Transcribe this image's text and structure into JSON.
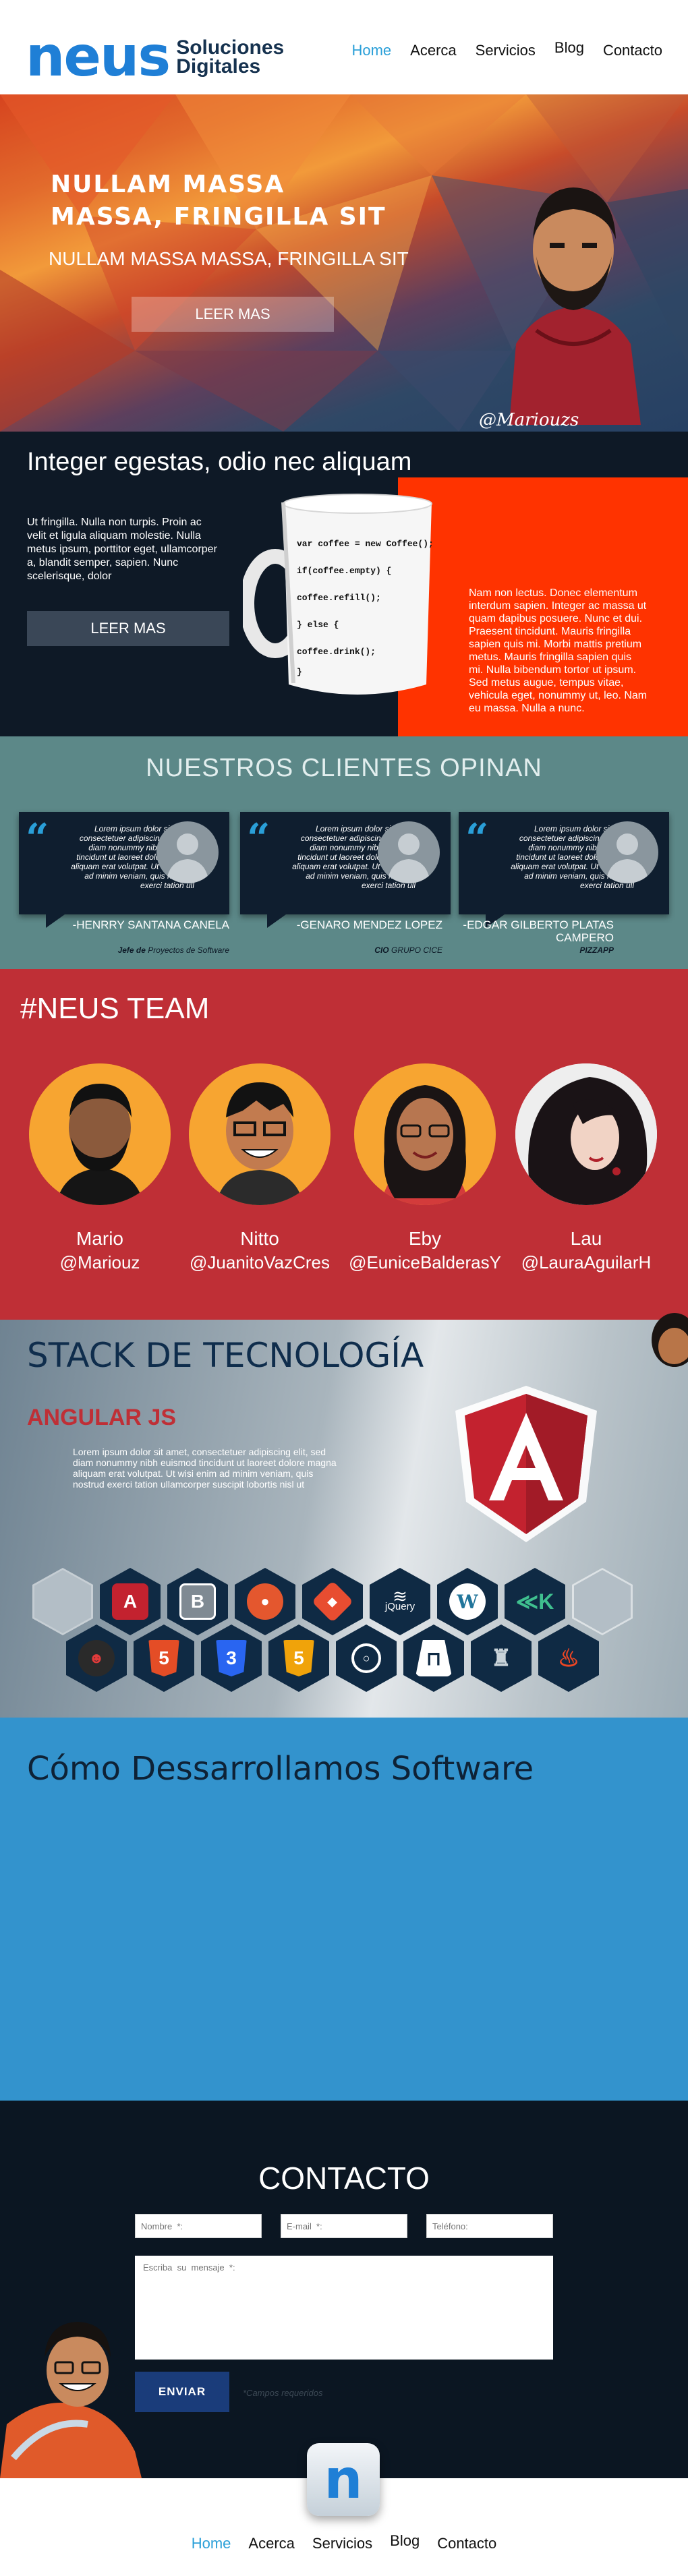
{
  "header": {
    "logo_mark": "neus",
    "logo_line1": "Soluciones",
    "logo_line2": "Digitales",
    "nav": [
      "Home",
      "Acerca",
      "Servicios",
      "Blog",
      "Contacto"
    ]
  },
  "hero": {
    "title": "NULLAM MASSA MASSA, FRINGILLA SIT",
    "subtitle": "NULLAM MASSA MASSA, FRINGILLA SIT",
    "button": "LEER MAS",
    "signature": "@Mariouzs"
  },
  "feature": {
    "title": "Integer egestas, odio nec aliquam",
    "text": "Ut fringilla. Nulla non turpis. Proin ac velit et ligula aliquam molestie. Nulla metus ipsum, porttitor eget, ullamcorper a, blandit semper, sapien. Nunc scelerisque, dolor",
    "button": "LEER MAS",
    "right_text": "Nam non lectus. Donec elementum interdum sapien. Integer ac massa ut quam dapibus posuere. Nunc et dui. Praesent tincidunt. Mauris fringilla sapien quis mi. Morbi mattis pretium metus. Mauris fringilla sapien quis mi. Nulla bibendum tortor ut ipsum. Sed metus augue, tempus vitae, vehicula eget, nonummy ut, leo. Nam eu massa. Nulla a nunc.",
    "mug_code": [
      "var coffee = new Coffee();",
      "if(coffee.empty) {",
      "  coffee.refill();",
      "} else {",
      "  coffee.drink();",
      "}"
    ]
  },
  "testimonials": {
    "title": "NUESTROS CLIENTES OPINAN",
    "quote_text": "Lorem ipsum dolor sit amet, consectetuer adipiscing elit, sed diam nonummy nibh euismod tincidunt ut laoreet dolore magna aliquam erat volutpat. Ut wisi enim ad minim veniam, quis nostrud exerci tation ull",
    "items": [
      {
        "name": "-HENRRY SANTANA CANELA",
        "role_prefix": "Jefe de",
        "role": "Proyectos de Software"
      },
      {
        "name": "-GENARO MENDEZ LOPEZ",
        "role_prefix": "CIO",
        "role": "GRUPO CICE"
      },
      {
        "name": "-EDGAR GILBERTO PLATAS CAMPERO",
        "role_prefix": "",
        "role": "PIZZAPP"
      }
    ]
  },
  "team": {
    "title": "#NEUS TEAM",
    "members": [
      {
        "name": "Mario",
        "handle": "@Mariouz"
      },
      {
        "name": "Nitto",
        "handle": "@JuanitoVazCres"
      },
      {
        "name": "Eby",
        "handle": "@EuniceBalderasY"
      },
      {
        "name": "Lau",
        "handle": "@LauraAguilarH"
      }
    ]
  },
  "stack": {
    "title": "STACK DE TECNOLOGÍA",
    "subtitle": "ANGULAR JS",
    "text": "Lorem ipsum dolor sit amet, consectetuer adipiscing elit, sed diam nonummy nibh euismod tincidunt ut laoreet dolore magna aliquam erat volutpat. Ut wisi enim ad minim veniam, quis nostrud exerci tation ullamcorper suscipit lobortis nisl ut",
    "tech_label_jquery": "jQuery"
  },
  "process": {
    "title": "Cómo Dessarrollamos Software"
  },
  "contact": {
    "title": "CONTACTO",
    "name_placeholder": "Nombre  *:",
    "email_placeholder": "E-mail  *:",
    "phone_placeholder": "Teléfono:",
    "message_placeholder": "Escriba  su  mensaje  *:",
    "send": "ENVIAR",
    "required_note": "*Campos   requeridos"
  },
  "footer": {
    "nav": [
      "Home",
      "Acerca",
      "Servicios",
      "Blog",
      "Contacto"
    ]
  },
  "colors": {
    "accent_blue": "#2a9fd8",
    "navy": "#0e1926",
    "orange_red": "#ff3300",
    "team_red": "#bf2f36",
    "testimonial_teal": "#5c8888",
    "process_blue": "#3393cd"
  }
}
